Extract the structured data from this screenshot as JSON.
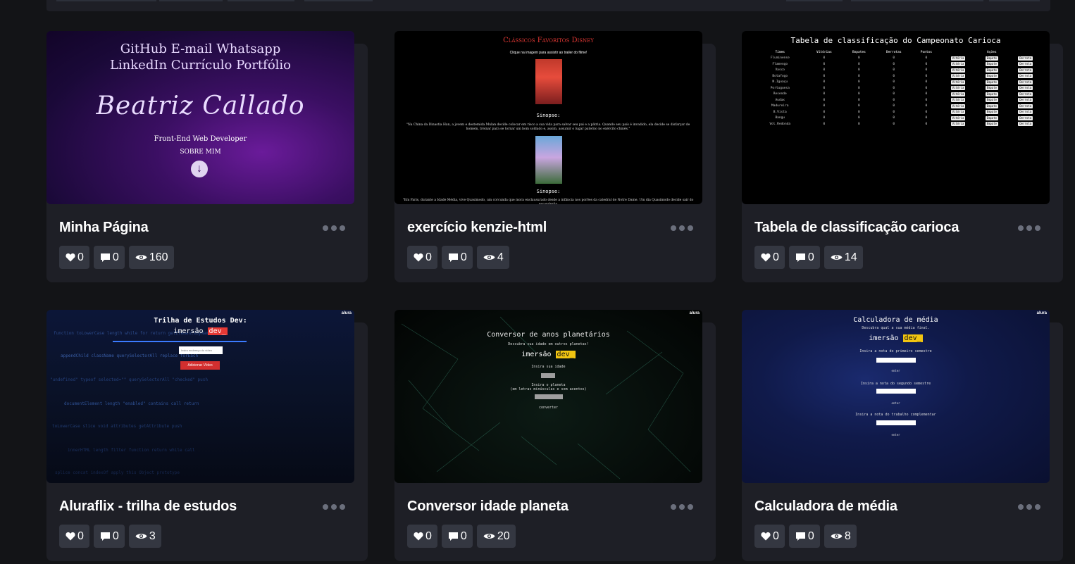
{
  "cards": [
    {
      "title": "Minha Página",
      "likes": "0",
      "comments": "0",
      "views": "160",
      "preview": {
        "nav_line1": "GitHub   E-mail   Whatsapp",
        "nav_line2": "LinkedIn   Currículo   Portfólio",
        "signature": "Beatriz Callado",
        "role": "Front-End Web Developer",
        "about": "SOBRE MIM"
      }
    },
    {
      "title": "exercício kenzie-html",
      "likes": "0",
      "comments": "0",
      "views": "4",
      "preview": {
        "heading": "Clássicos Favoritos Disney",
        "subtitle": "Clique na imagem para assistir ao trailer do filme!",
        "sinopse_label": "Sinopse:",
        "text1": "\"Na China da Dinastia Han, a jovem e destemida Mulan decide colocar em risco a sua vida para salvar seu pai e a pátria. Quando seu país é invadido, ela decide se disfarçar de homem, treinar para se tornar um bom soldado e, assim, assumir o lugar paterno no exército chinês.\"",
        "text2": "\"Em Paris, durante a Idade Média, vive Quasimodo, um corcunda que mora enclausurado desde a infância nos porões da catedral de Notre Dame. Um dia Quasimodo decide sair do esconderijo"
      }
    },
    {
      "title": "Tabela de classificação carioca",
      "likes": "0",
      "comments": "0",
      "views": "14",
      "preview": {
        "heading": "Tabela de classificação do Campeonato Carioca",
        "columns": [
          "Times",
          "Vitórias",
          "Empates",
          "Derrotas",
          "Pontos",
          "",
          "Ações",
          ""
        ],
        "teams": [
          "Fluminense",
          "Flamengo",
          "Vasco",
          "Botafogo",
          "N.Iguaçu",
          "Portuguesa",
          "Resende",
          "Audax",
          "Madureira",
          "B.Vista",
          "Bangu",
          "Vol.Redonda"
        ],
        "btn_win": "Vitória",
        "btn_draw": "Empate",
        "btn_loss": "Derrota"
      }
    },
    {
      "title": "Aluraflix - trilha de estudos",
      "likes": "0",
      "comments": "0",
      "views": "3",
      "preview": {
        "heading": "Trilha de Estudos Dev:",
        "brand1": "imersão",
        "brand2": "dev_",
        "input_placeholder": "Insira endereço do vídeo",
        "button": "Adicionar Vídeo",
        "alura": "alura"
      }
    },
    {
      "title": "Conversor idade planeta",
      "likes": "0",
      "comments": "0",
      "views": "20",
      "preview": {
        "heading": "Conversor de anos planetários",
        "subtitle": "Descubra sua idade em outros planetas!",
        "brand1": "imersão",
        "brand2": "dev_",
        "label1": "Insira sua idade",
        "label2": "Insira o planeta",
        "label2b": "(em letras minúsculas e sem acentos)",
        "button": "converter",
        "alura": "alura"
      }
    },
    {
      "title": "Calculadora de média",
      "likes": "0",
      "comments": "0",
      "views": "8",
      "preview": {
        "heading": "Calculadora de média",
        "subtitle": "Descubra qual a sua média final.",
        "brand1": "imersão",
        "brand2": "dev_",
        "label1": "Insira a nota do primeiro semestre",
        "label2": "Insira a nota do segundo semestre",
        "label3": "Insira a nota do trabalho complementar",
        "button": "enter",
        "alura": "alura"
      }
    }
  ],
  "colors": {
    "page_bg": "#131417",
    "card_bg": "#1e1f26",
    "stat_bg": "#343741",
    "title": "#ffffff"
  },
  "icons": {
    "likes": "heart-icon",
    "comments": "comment-icon",
    "views": "eye-icon",
    "more": "more-dots-icon"
  }
}
